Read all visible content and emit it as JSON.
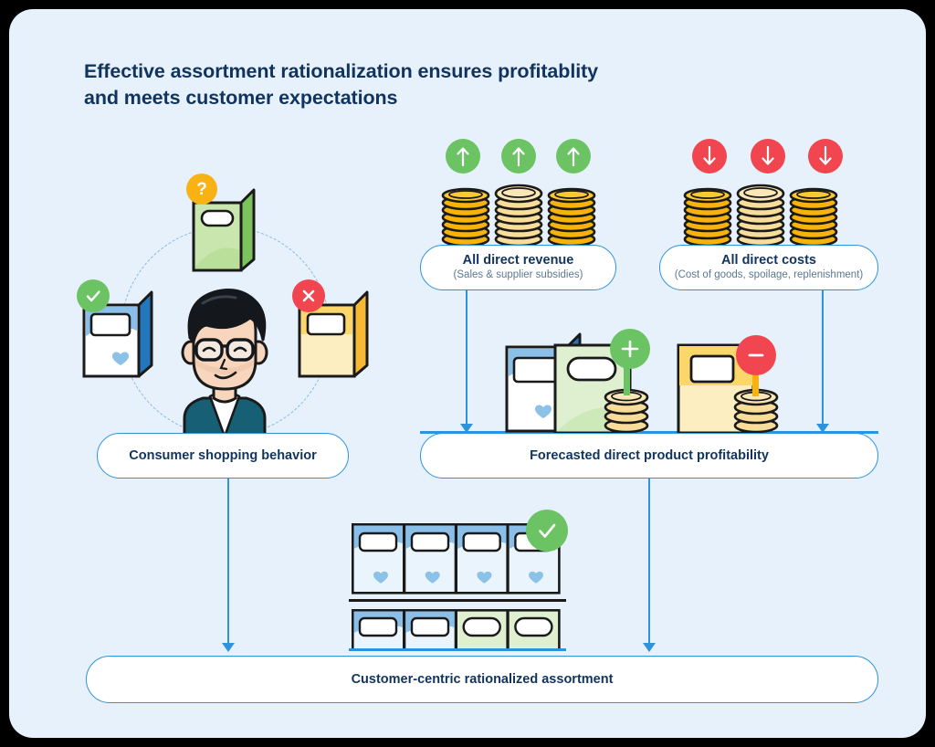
{
  "panel": {
    "background_color": "#e6f1fc",
    "border_radius": "26px"
  },
  "title": {
    "line1": "Effective assortment rationalization ensures profitablity",
    "line2": "and meets customer expectations",
    "color": "#11345e"
  },
  "colors": {
    "accent_blue": "#2e93dd",
    "navy_text": "#11345e",
    "subtext": "#5b7892",
    "green": "#6cc364",
    "red": "#f1464f",
    "orange": "#f9b213",
    "gold_dark": "#f7b30c",
    "gold_light": "#f7dc9a",
    "box_blue": "#89bfe8",
    "box_blue_dark": "#2477bd",
    "box_green": "#bfe3a8",
    "box_green_dark": "#7cc35e",
    "box_yellow": "#fbd76b",
    "box_yellow_dark": "#f7b834",
    "panel_bg": "#e6f1fc"
  },
  "nodes": {
    "revenue": {
      "title": "All direct revenue",
      "subtitle": "(Sales & supplier subsidies)"
    },
    "costs": {
      "title": "All direct costs",
      "subtitle": "(Cost of goods, spoilage, replenishment)"
    },
    "consumer": {
      "title": "Consumer shopping behavior"
    },
    "forecast": {
      "title": "Forecasted direct product profitability"
    },
    "assortment": {
      "title": "Customer-centric rationalized assortment"
    }
  },
  "revenue_indicators": [
    {
      "direction": "up",
      "color": "#6cc364",
      "glyph": "↑"
    },
    {
      "direction": "up",
      "color": "#6cc364",
      "glyph": "↑"
    },
    {
      "direction": "up",
      "color": "#6cc364",
      "glyph": "↑"
    }
  ],
  "cost_indicators": [
    {
      "direction": "down",
      "color": "#f1464f",
      "glyph": "↓"
    },
    {
      "direction": "down",
      "color": "#f1464f",
      "glyph": "↓"
    },
    {
      "direction": "down",
      "color": "#f1464f",
      "glyph": "↓"
    }
  ],
  "consumer_products": [
    {
      "name": "question-product",
      "badge": "?",
      "badge_color": "#f9b213",
      "box_color": "#c8e6ae"
    },
    {
      "name": "accepted-product",
      "badge": "✓",
      "badge_color": "#6cc364",
      "box_color": "#9ccdec"
    },
    {
      "name": "rejected-product",
      "badge": "✗",
      "badge_color": "#f1464f",
      "box_color": "#fbd76b"
    }
  ],
  "profitability_products": [
    {
      "name": "profitable-product",
      "badge": "+",
      "badge_color": "#6cc364"
    },
    {
      "name": "unprofitable-product",
      "badge": "−",
      "badge_color": "#f1464f"
    }
  ],
  "shelf": {
    "badge": "✓",
    "badge_color": "#6cc364",
    "top_row": [
      "blue",
      "blue",
      "blue",
      "blue"
    ],
    "bottom_row": [
      "blue",
      "blue",
      "green",
      "green"
    ]
  },
  "connectors": [
    {
      "from": "revenue",
      "to": "forecast"
    },
    {
      "from": "costs",
      "to": "forecast"
    },
    {
      "from": "consumer",
      "to": "assortment"
    },
    {
      "from": "forecast",
      "to": "assortment"
    }
  ]
}
